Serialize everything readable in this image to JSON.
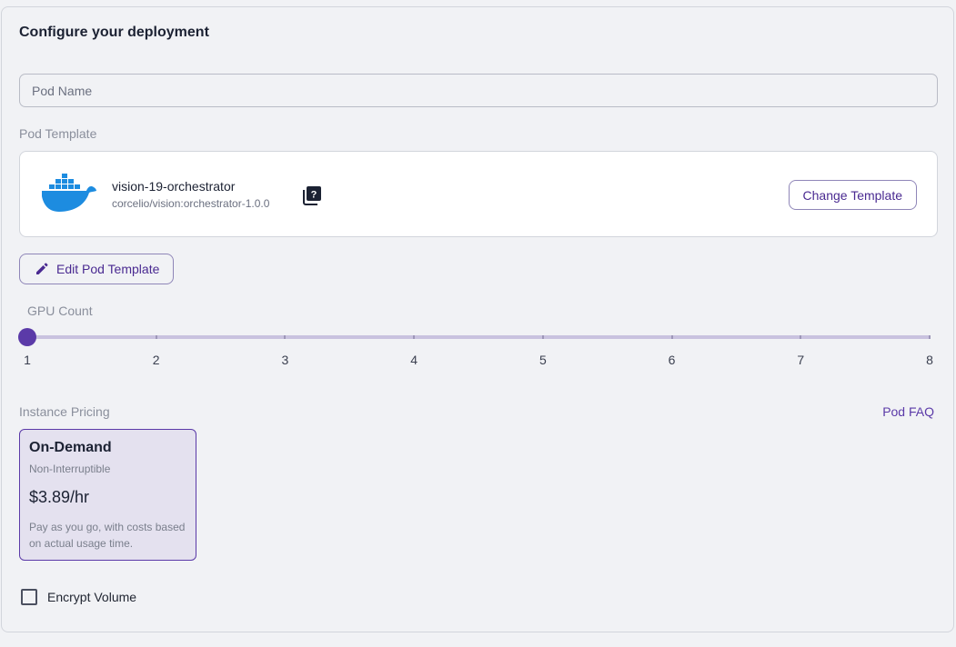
{
  "title": "Configure your deployment",
  "pod_name": {
    "placeholder": "Pod Name",
    "value": ""
  },
  "pod_template": {
    "label": "Pod Template",
    "name": "vision-19-orchestrator",
    "image": "corcelio/vision:orchestrator-1.0.0",
    "icon": "docker-icon",
    "help_icon": "help-book-icon",
    "change_label": "Change Template"
  },
  "edit_template": {
    "label": "Edit Pod Template",
    "icon": "pencil-icon"
  },
  "gpu_count": {
    "label": "GPU Count",
    "min": 1,
    "max": 8,
    "value": 1,
    "ticks": [
      "1",
      "2",
      "3",
      "4",
      "5",
      "6",
      "7",
      "8"
    ]
  },
  "pricing": {
    "label": "Instance Pricing",
    "faq_label": "Pod FAQ",
    "options": [
      {
        "title": "On-Demand",
        "subtitle": "Non-Interruptible",
        "price": "$3.89/hr",
        "description": "Pay as you go, with costs based on actual usage time.",
        "selected": true
      }
    ]
  },
  "encrypt_volume": {
    "label": "Encrypt Volume",
    "checked": false
  },
  "colors": {
    "accent": "#5b3aa8",
    "docker_blue": "#1d8ce0",
    "background": "#f1f2f5"
  }
}
